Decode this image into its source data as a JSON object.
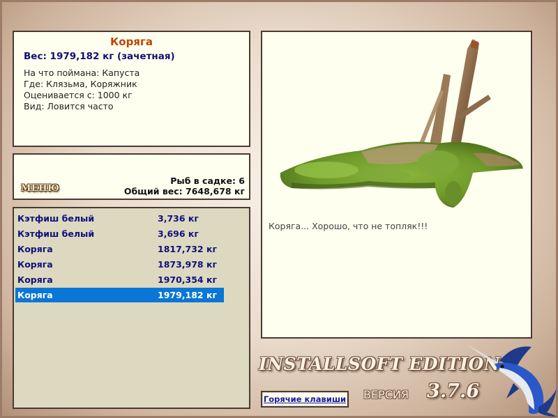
{
  "info": {
    "title": "Коряга",
    "weight_line": "Вес: 1979,182 кг (зачетная)",
    "details": [
      "На что поймана: Капуста",
      "Где: Клязьма, Коряжник",
      "Оценивается с: 1000 кг",
      "Вид: Ловится часто"
    ]
  },
  "keepnet": {
    "menu_label": "МЕНЮ",
    "fish_count": "Рыб в садке: 6",
    "total_weight": "Общий вес: 7648,678 кг"
  },
  "catches": [
    {
      "name": "Кэтфиш белый",
      "weight": "3,736 кг"
    },
    {
      "name": "Кэтфиш белый",
      "weight": "3,696 кг"
    },
    {
      "name": "Коряга",
      "weight": "1817,732 кг"
    },
    {
      "name": "Коряга",
      "weight": "1873,978 кг"
    },
    {
      "name": "Коряга",
      "weight": "1970,354 кг"
    },
    {
      "name": "Коряга",
      "weight": "1979,182 кг",
      "selected": true
    }
  ],
  "picture": {
    "comment": "Коряга... Хорошо, что не топляк!!!"
  },
  "branding": {
    "edition": "INSTALLSOFT EDITION",
    "version_label": "ВЕРСИЯ",
    "version_number": "3.7.6",
    "hotkeys_label": "Горячие клавиши"
  },
  "colors": {
    "title": "#c04400",
    "weight": "#101070",
    "list_text": "#10107a",
    "selection": "#0a76d6",
    "panel_bg": "#fffff0",
    "list_bg": "#ddd9c1"
  },
  "icons": {
    "picture": "driftwood-snag-image",
    "logo": "marlin-fish-logo"
  }
}
